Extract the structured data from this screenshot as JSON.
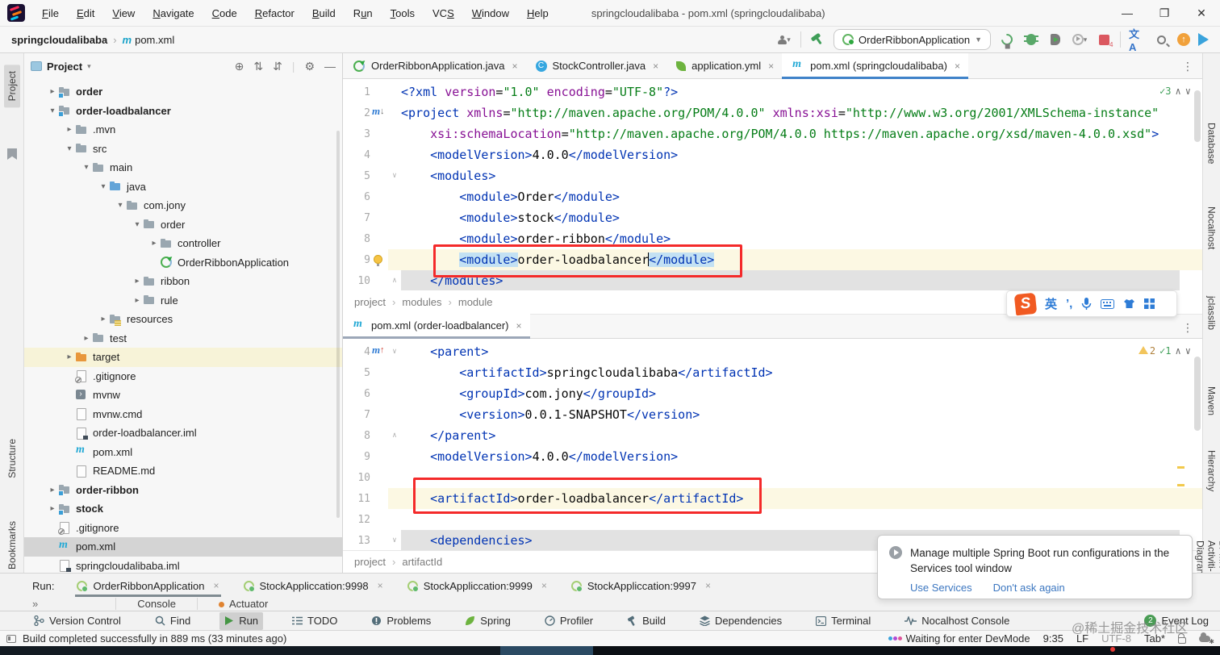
{
  "window": {
    "title": "springcloudalibaba - pom.xml (springcloudalibaba)",
    "menus": [
      {
        "label": "File",
        "u": 0
      },
      {
        "label": "Edit",
        "u": 0
      },
      {
        "label": "View",
        "u": 0
      },
      {
        "label": "Navigate",
        "u": 0
      },
      {
        "label": "Code",
        "u": 0
      },
      {
        "label": "Refactor",
        "u": 0
      },
      {
        "label": "Build",
        "u": 0
      },
      {
        "label": "Run",
        "u": 1
      },
      {
        "label": "Tools",
        "u": 0
      },
      {
        "label": "VCS",
        "u": 2
      },
      {
        "label": "Window",
        "u": 0
      },
      {
        "label": "Help",
        "u": 0
      }
    ],
    "controls": {
      "minimize": "—",
      "restore": "❐",
      "close": "✕"
    }
  },
  "toolbar": {
    "breadcrumb_project": "springcloudalibaba",
    "breadcrumb_file": "pom.xml",
    "run_config": "OrderRibbonApplication",
    "icons": [
      "user-dropdown",
      "build-hammer",
      "rerun",
      "debug",
      "run-with-coverage",
      "profiler",
      "stop",
      "translate",
      "search",
      "update",
      "play-plugin"
    ],
    "stop_count": "4"
  },
  "left_stripe": {
    "top": "Project",
    "middle": "Structure",
    "bottom": "Bookmarks"
  },
  "right_stripe": [
    "Database",
    "Nocalhost",
    "jclasslib",
    "Maven",
    "Hierarchy",
    "BPMN-Activiti-Diagram"
  ],
  "project_panel": {
    "title": "Project",
    "tree": [
      {
        "level": 0,
        "arrow": "▸",
        "icon": "folder mod",
        "label": "order",
        "bold": true
      },
      {
        "level": 0,
        "arrow": "▾",
        "icon": "folder mod",
        "label": "order-loadbalancer",
        "bold": true
      },
      {
        "level": 1,
        "arrow": "▸",
        "icon": "folder",
        "label": ".mvn"
      },
      {
        "level": 1,
        "arrow": "▾",
        "icon": "folder",
        "label": "src"
      },
      {
        "level": 2,
        "arrow": "▾",
        "icon": "folder",
        "label": "main"
      },
      {
        "level": 3,
        "arrow": "▾",
        "icon": "folder java",
        "label": "java"
      },
      {
        "level": 4,
        "arrow": "▾",
        "icon": "pkg",
        "label": "com.jony"
      },
      {
        "level": 5,
        "arrow": "▾",
        "icon": "pkg",
        "label": "order"
      },
      {
        "level": 6,
        "arrow": "▸",
        "icon": "pkg",
        "label": "controller"
      },
      {
        "level": 6,
        "arrow": "",
        "icon": "boot",
        "label": "OrderRibbonApplication"
      },
      {
        "level": 5,
        "arrow": "▸",
        "icon": "pkg",
        "label": "ribbon"
      },
      {
        "level": 5,
        "arrow": "▸",
        "icon": "pkg",
        "label": "rule"
      },
      {
        "level": 3,
        "arrow": "▸",
        "icon": "folder res",
        "label": "resources"
      },
      {
        "level": 2,
        "arrow": "▸",
        "icon": "folder",
        "label": "test"
      },
      {
        "level": 1,
        "arrow": "▸",
        "icon": "folder target",
        "label": "target",
        "hl": true
      },
      {
        "level": 1,
        "arrow": "",
        "icon": "doc ign",
        "label": ".gitignore"
      },
      {
        "level": 1,
        "arrow": "",
        "icon": "mvnw",
        "label": "mvnw"
      },
      {
        "level": 1,
        "arrow": "",
        "icon": "doc",
        "label": "mvnw.cmd"
      },
      {
        "level": 1,
        "arrow": "",
        "icon": "doc iml",
        "label": "order-loadbalancer.iml"
      },
      {
        "level": 1,
        "arrow": "",
        "icon": "mvn",
        "label": "pom.xml"
      },
      {
        "level": 1,
        "arrow": "",
        "icon": "doc md",
        "label": "README.md"
      },
      {
        "level": 0,
        "arrow": "▸",
        "icon": "folder mod",
        "label": "order-ribbon",
        "bold": true
      },
      {
        "level": 0,
        "arrow": "▸",
        "icon": "folder mod",
        "label": "stock",
        "bold": true
      },
      {
        "level": 0,
        "arrow": "",
        "icon": "doc ign",
        "label": ".gitignore"
      },
      {
        "level": 0,
        "arrow": "",
        "icon": "mvn",
        "label": "pom.xml",
        "sel": true
      },
      {
        "level": 0,
        "arrow": "",
        "icon": "doc iml",
        "label": "springcloudalibaba.iml"
      }
    ]
  },
  "editor_tabs": [
    {
      "label": "OrderRibbonApplication.java",
      "icon": "boot",
      "close": "×"
    },
    {
      "label": "StockController.java",
      "icon": "classC",
      "close": "×"
    },
    {
      "label": "application.yml",
      "icon": "leaf",
      "close": "×"
    },
    {
      "label": "pom.xml (springcloudalibaba)",
      "icon": "mvn",
      "close": "×",
      "active": true
    }
  ],
  "editor1": {
    "inspection": {
      "ok": "3",
      "up": "∧",
      "down": "∨"
    },
    "lines": [
      {
        "n": "1",
        "toks": [
          [
            "tag",
            "<?xml "
          ],
          [
            "attr",
            "version"
          ],
          [
            "txt",
            "="
          ],
          [
            "str",
            "\"1.0\""
          ],
          [
            "txt",
            " "
          ],
          [
            "attr",
            "encoding"
          ],
          [
            "txt",
            "="
          ],
          [
            "str",
            "\"UTF-8\""
          ],
          [
            "tag",
            "?>"
          ]
        ]
      },
      {
        "n": "2",
        "g": "m-down",
        "toks": [
          [
            "tag",
            "<project "
          ],
          [
            "attr",
            "xmlns"
          ],
          [
            "txt",
            "="
          ],
          [
            "str",
            "\"http://maven.apache.org/POM/4.0.0\""
          ],
          [
            "txt",
            " "
          ],
          [
            "attr",
            "xmlns:xsi"
          ],
          [
            "txt",
            "="
          ],
          [
            "str",
            "\"http://www.w3.org/2001/XMLSchema-instance\""
          ]
        ]
      },
      {
        "n": "3",
        "toks": [
          [
            "txt",
            "    "
          ],
          [
            "attr",
            "xsi:schemaLocation"
          ],
          [
            "txt",
            "="
          ],
          [
            "str",
            "\"http://maven.apache.org/POM/4.0.0 https://maven.apache.org/xsd/maven-4.0.0.xsd\""
          ],
          [
            "tag",
            ">"
          ]
        ]
      },
      {
        "n": "4",
        "toks": [
          [
            "txt",
            "    "
          ],
          [
            "tag",
            "<modelVersion>"
          ],
          [
            "txt",
            "4.0.0"
          ],
          [
            "tag",
            "</modelVersion>"
          ]
        ]
      },
      {
        "n": "5",
        "f": "∨",
        "toks": [
          [
            "txt",
            "    "
          ],
          [
            "tag",
            "<modules>"
          ]
        ]
      },
      {
        "n": "6",
        "toks": [
          [
            "txt",
            "        "
          ],
          [
            "tag",
            "<module>"
          ],
          [
            "txt",
            "Order"
          ],
          [
            "tag",
            "</module>"
          ]
        ]
      },
      {
        "n": "7",
        "toks": [
          [
            "txt",
            "        "
          ],
          [
            "tag",
            "<module>"
          ],
          [
            "txt",
            "stock"
          ],
          [
            "tag",
            "</module>"
          ]
        ]
      },
      {
        "n": "8",
        "toks": [
          [
            "txt",
            "        "
          ],
          [
            "tag",
            "<module>"
          ],
          [
            "txt",
            "order-ribbon"
          ],
          [
            "tag",
            "</module>"
          ]
        ]
      },
      {
        "n": "9",
        "g": "bulb",
        "cur": true,
        "toks": [
          [
            "txt",
            "        "
          ],
          [
            "tagh",
            "<module>"
          ],
          [
            "txt",
            "order-loadbalancer"
          ],
          [
            "caret",
            ""
          ],
          [
            "tagh",
            "</module>"
          ]
        ]
      },
      {
        "n": "10",
        "f": "∧",
        "bar": true,
        "toks": [
          [
            "txt",
            "    "
          ],
          [
            "tag",
            "</modules>"
          ]
        ]
      }
    ]
  },
  "breadcrumb1": [
    "project",
    "modules",
    "module"
  ],
  "editor2_tab": {
    "label": "pom.xml (order-loadbalancer)",
    "close": "×"
  },
  "editor2": {
    "inspection": {
      "warn": "2",
      "ok": "1",
      "up": "∧",
      "down": "∨"
    },
    "lines": [
      {
        "n": "4",
        "g": "m-up",
        "f": "∨",
        "toks": [
          [
            "txt",
            "    "
          ],
          [
            "tag",
            "<parent>"
          ]
        ]
      },
      {
        "n": "5",
        "toks": [
          [
            "txt",
            "        "
          ],
          [
            "tag",
            "<artifactId>"
          ],
          [
            "txt",
            "springcloudalibaba"
          ],
          [
            "tag",
            "</artifactId>"
          ]
        ]
      },
      {
        "n": "6",
        "toks": [
          [
            "txt",
            "        "
          ],
          [
            "tag",
            "<groupId>"
          ],
          [
            "txt",
            "com.jony"
          ],
          [
            "tag",
            "</groupId>"
          ]
        ]
      },
      {
        "n": "7",
        "toks": [
          [
            "txt",
            "        "
          ],
          [
            "tag",
            "<version>"
          ],
          [
            "txt",
            "0.0.1-SNAPSHOT"
          ],
          [
            "tag",
            "</version>"
          ]
        ]
      },
      {
        "n": "8",
        "f": "∧",
        "toks": [
          [
            "txt",
            "    "
          ],
          [
            "tag",
            "</parent>"
          ]
        ]
      },
      {
        "n": "9",
        "toks": [
          [
            "txt",
            "    "
          ],
          [
            "tag",
            "<modelVersion>"
          ],
          [
            "txt",
            "4.0.0"
          ],
          [
            "tag",
            "</modelVersion>"
          ]
        ]
      },
      {
        "n": "10",
        "toks": []
      },
      {
        "n": "11",
        "cur": true,
        "toks": [
          [
            "txt",
            "    "
          ],
          [
            "tag",
            "<artifactId>"
          ],
          [
            "txt",
            "order-loadbalancer"
          ],
          [
            "tag",
            "</artifactId>"
          ]
        ]
      },
      {
        "n": "12",
        "toks": []
      },
      {
        "n": "13",
        "f": "∨",
        "bar": true,
        "toks": [
          [
            "txt",
            "    "
          ],
          [
            "tag",
            "<dependencies>"
          ]
        ]
      }
    ]
  },
  "breadcrumb2": [
    "project",
    "artifactId"
  ],
  "ime": {
    "logo": "S",
    "lang": "英",
    "punct": "’,",
    "icons": [
      "sogou-logo",
      "english-mode",
      "punctuation",
      "microphone-icon",
      "keyboard-icon",
      "skin-icon",
      "toolbox-icon"
    ]
  },
  "notification": {
    "message": "Manage multiple Spring Boot run configurations in the Services tool window",
    "actions": [
      "Use Services",
      "Don't ask again"
    ]
  },
  "run_panel": {
    "label": "Run:",
    "tabs": [
      {
        "label": "OrderRibbonApplication",
        "active": true,
        "close": "×"
      },
      {
        "label": "StockAppliccation:9998",
        "close": "×"
      },
      {
        "label": "StockAppliccation:9999",
        "close": "×"
      },
      {
        "label": "StockAppliccation:9997",
        "close": "×"
      }
    ],
    "more": "»",
    "subtabs": [
      {
        "label": "Console"
      },
      {
        "label": "Actuator",
        "dot": true
      }
    ]
  },
  "bottom_bar": {
    "items": [
      {
        "label": "Version Control",
        "icon": "branch"
      },
      {
        "label": "Find",
        "icon": "search"
      },
      {
        "label": "Run",
        "icon": "play",
        "active": true
      },
      {
        "label": "TODO",
        "icon": "todo"
      },
      {
        "label": "Problems",
        "icon": "problems"
      },
      {
        "label": "Spring",
        "icon": "leaf"
      },
      {
        "label": "Profiler",
        "icon": "profiler"
      },
      {
        "label": "Build",
        "icon": "hammer"
      },
      {
        "label": "Dependencies",
        "icon": "deps"
      },
      {
        "label": "Terminal",
        "icon": "terminal"
      },
      {
        "label": "Nocalhost Console",
        "icon": "pulse"
      }
    ],
    "event_log": {
      "label": "Event Log",
      "badge": "2"
    }
  },
  "status_bar": {
    "message": "Build completed successfully in 889 ms (33 minutes ago)",
    "devmode": "Waiting for enter DevMode",
    "time": "9:35",
    "line_ending": "LF",
    "encoding": "UTF-8",
    "indent": "Tab*"
  },
  "watermark": "@稀土掘金技术社区",
  "colors": {
    "accent": "#4083c9",
    "red_box": "#f42a2a",
    "tag": "#0033b3",
    "attr": "#871094",
    "string": "#067d17",
    "current_line": "#fcf8e3",
    "tag_match": "#c3e1f3",
    "event_badge": "#499c54"
  }
}
